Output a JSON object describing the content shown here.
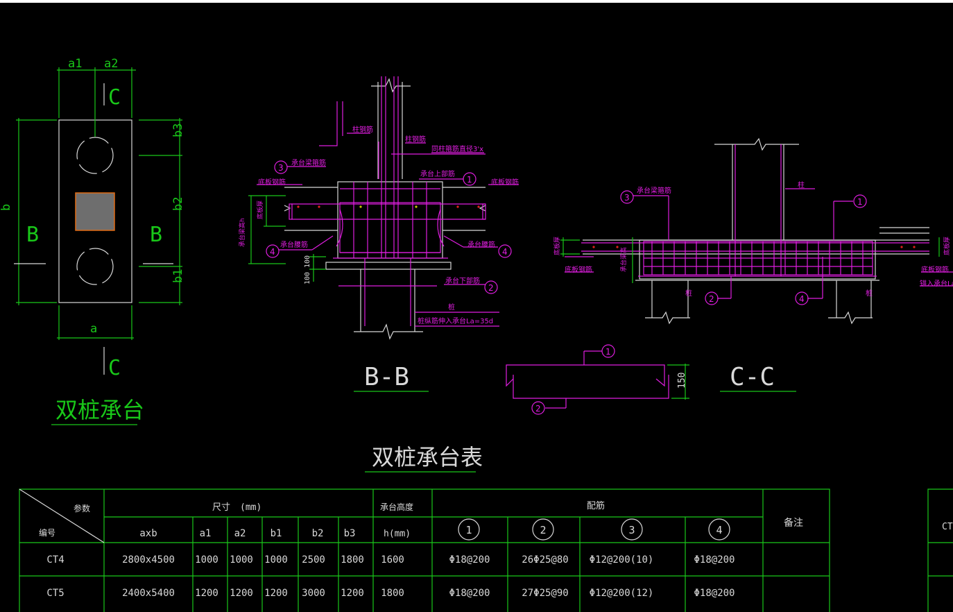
{
  "plan": {
    "label_a1": "a1",
    "label_a2": "a2",
    "label_b": "b",
    "label_a": "a",
    "label_b1": "b1",
    "label_b2": "b2",
    "label_b3": "b3",
    "section_letter_B": "B",
    "section_letter_C": "C",
    "title": "双桩承台"
  },
  "section_bb": {
    "title": "B-B",
    "label_column_bar": "柱钢筋",
    "label_column_bar2": "柱钢筋",
    "label_stirrup": "同柱箍筋直径3'x",
    "label_beam_bar": "承台梁箍筋",
    "label_top_bar": "承台上部筋",
    "label_bottom_slab_left": "底板钢筋",
    "label_bottom_slab_right": "底板钢筋",
    "label_side_bar_left": "承台腰筋",
    "label_side_bar_right": "承台腰筋",
    "label_bottom_bar": "承台下部筋",
    "label_pile": "桩",
    "label_anchor": "桩纵筋伸入承台La=35d",
    "label_slab_thk": "底板厚",
    "label_beam_h": "承台梁高h",
    "dim_100a": "100",
    "dim_100b": "100",
    "marker_1": "1",
    "marker_2": "2",
    "marker_3": "3",
    "marker_4": "4",
    "marker_4b": "4"
  },
  "section_cc": {
    "title": "C-C",
    "label_column": "柱",
    "label_beam_bar": "承台梁箍筋",
    "label_bottom_slab_left": "底板钢筋",
    "label_bottom_slab_right": "底板钢筋",
    "label_anchor_right": "锚入承台La",
    "label_slab_thk_left": "底板厚",
    "label_slab_thk_right": "底板厚",
    "label_beam_h": "承台梁高",
    "label_pile_left": "桩",
    "label_pile_right": "桩",
    "marker_1": "1",
    "marker_2": "2",
    "marker_3": "3",
    "marker_4": "4"
  },
  "detail": {
    "dim_150": "150",
    "marker_1": "1",
    "marker_2": "2"
  },
  "table": {
    "title": "双桩承台表",
    "header_param": "参数",
    "header_no": "编号",
    "header_size": "尺寸",
    "header_size_unit": "(mm)",
    "header_height": "承台高度",
    "header_height_unit": "h(mm)",
    "header_rebar": "配筋",
    "header_note": "备注",
    "sub_headers": [
      "axb",
      "a1",
      "a2",
      "b1",
      "b2",
      "b3"
    ],
    "rebar_markers": [
      "1",
      "2",
      "3",
      "4"
    ],
    "rows": [
      {
        "no": "CT4",
        "axb": "2800x4500",
        "a1": "1000",
        "a2": "1000",
        "b1": "1000",
        "b2": "2500",
        "b3": "1800",
        "h": "1600",
        "r1": "Φ18@200",
        "r2": "26Φ25@80",
        "r3": "Φ12@200(10)",
        "r4": "Φ18@200",
        "note": ""
      },
      {
        "no": "CT5",
        "axb": "2400x5400",
        "a1": "1200",
        "a2": "1200",
        "b1": "1200",
        "b2": "3000",
        "b3": "1200",
        "h": "1800",
        "r1": "Φ18@200",
        "r2": "27Φ25@90",
        "r3": "Φ12@200(12)",
        "r4": "Φ18@200",
        "note": ""
      }
    ],
    "partial_right_text": "CT"
  },
  "colors": {
    "background": "#000000",
    "outline": "#d9d9d9",
    "dimension": "#19c819",
    "rebar": "#e01ee0",
    "column_fill": "#6e6e6e",
    "column_edge": "#e06a14"
  }
}
